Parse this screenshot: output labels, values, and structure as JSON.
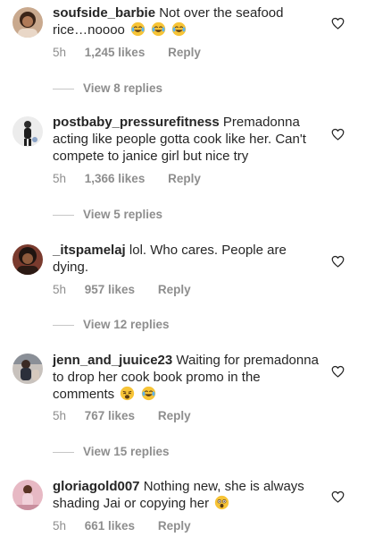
{
  "comments": [
    {
      "username": "soufside_barbie",
      "text": "Not over the seafood rice…noooo",
      "time": "5h",
      "likes": "1,245 likes",
      "reply": "Reply",
      "view_replies": "View 8 replies"
    },
    {
      "username": "postbaby_pressurefitness",
      "text": "Premadonna acting like people gotta cook like her. Can't compete to janice girl but nice try",
      "time": "5h",
      "likes": "1,366 likes",
      "reply": "Reply",
      "view_replies": "View 5 replies"
    },
    {
      "username": "_itspamelaj",
      "text": "lol. Who cares. People are dying.",
      "time": "5h",
      "likes": "957 likes",
      "reply": "Reply",
      "view_replies": "View 12 replies"
    },
    {
      "username": "jenn_and_juuice23",
      "text": "Waiting for premadonna to drop her cook book promo in the comments",
      "time": "5h",
      "likes": "767 likes",
      "reply": "Reply",
      "view_replies": "View 15 replies"
    },
    {
      "username": "gloriagold007",
      "text": "Nothing new, she is always shading Jai or copying her",
      "time": "5h",
      "likes": "661 likes",
      "reply": "Reply"
    }
  ],
  "icons": {
    "like": "heart-outline-icon",
    "crying_laughing": "crying-laughing-emoji",
    "weary": "weary-face-emoji",
    "flushed": "astonished-face-emoji"
  },
  "colors": {
    "text": "#262626",
    "secondary": "#8e8e8e",
    "emoji": "#f7c437"
  }
}
